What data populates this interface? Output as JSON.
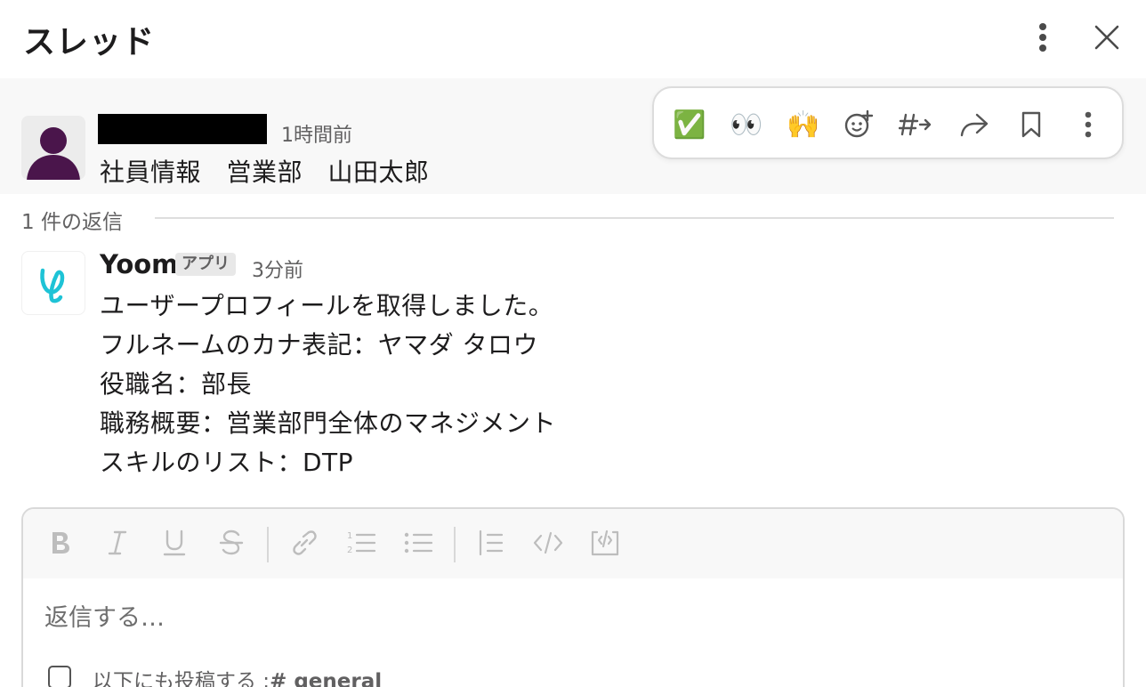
{
  "header": {
    "title": "スレッド",
    "more_icon": "kebab-icon",
    "close_icon": "close-icon"
  },
  "parent_message": {
    "time": "1時間前",
    "text": "社員情報　営業部　山田太郎"
  },
  "hover_toolbar": {
    "items": [
      {
        "name": "white-check-mark-icon",
        "glyph": "✅"
      },
      {
        "name": "eyes-icon",
        "glyph": "👀"
      },
      {
        "name": "raised-hands-icon",
        "glyph": "🙌"
      },
      {
        "name": "add-reaction-icon"
      },
      {
        "name": "reply-in-channel-icon"
      },
      {
        "name": "forward-icon"
      },
      {
        "name": "bookmark-icon"
      },
      {
        "name": "more-actions-icon"
      }
    ]
  },
  "replies": {
    "count_label": "1 件の返信"
  },
  "reply": {
    "author": "Yoom",
    "badge": "アプリ",
    "time": "3分前",
    "lines": [
      "ユーザープロフィールを取得しました。",
      "フルネームのカナ表記：ヤマダ タロウ",
      "役職名：部長",
      "職務概要：営業部門全体のマネジメント",
      "スキルのリスト：DTP"
    ]
  },
  "composer": {
    "placeholder": "返信する…",
    "also_send_label": "以下にも投稿する :",
    "also_send_channel": "# general"
  }
}
